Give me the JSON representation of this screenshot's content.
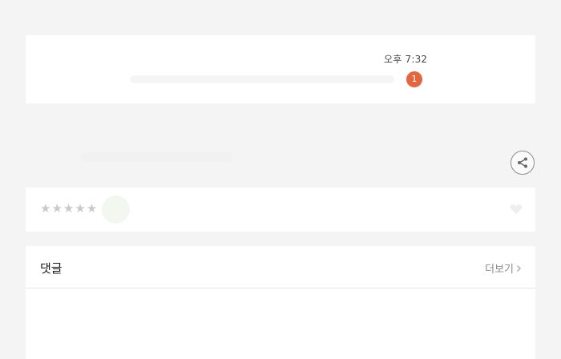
{
  "message_card": {
    "time": "오후 7:32",
    "unread_count": "1"
  },
  "rating": {
    "stars": "★★★★★"
  },
  "comments": {
    "title": "댓글",
    "more_label": "더보기"
  },
  "icons": {
    "share": "share-icon",
    "like": "heart-icon",
    "more": "chevron-right-icon"
  },
  "colors": {
    "background": "#f4f4f4",
    "card": "#ffffff",
    "badge": "#e3663e",
    "star": "#c9c9c9"
  }
}
